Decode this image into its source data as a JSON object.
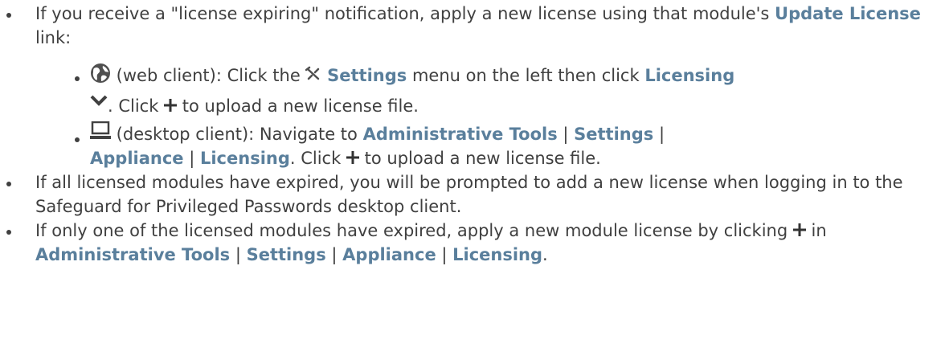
{
  "bullets": [
    {
      "pre": "If you receive a \"license expiring\" notification, apply a new license using that module's ",
      "bold1": "Update License",
      "post": " link:",
      "sub": [
        {
          "icon": "globe-icon",
          "t1": " (web client): Click the ",
          "icon2": "wrench-icon",
          "b1": "Settings",
          "t2": " menu on the left then click ",
          "b2": "Licensing",
          "icon3": "chevron-down-icon",
          "t3": ". Click ",
          "icon4": "plus-icon",
          "t4": " to upload a new license file."
        },
        {
          "icon": "desktop-icon",
          "t1": " (desktop client): Navigate to ",
          "b1": "Administrative Tools",
          "sep1": " | ",
          "b2": "Settings",
          "sep2": " | ",
          "b3": "Appliance",
          "sep3": " | ",
          "b4": "Licensing",
          "t2": ". Click ",
          "icon2": "plus-icon",
          "t3": " to upload a new license file."
        }
      ]
    },
    {
      "text": "If all licensed modules have expired, you will be prompted to add a new license when logging in to the Safeguard for Privileged Passwords desktop client."
    },
    {
      "t1": "If only one of the licensed modules have expired, apply a new module license by clicking ",
      "icon": "plus-icon",
      "t2": " in ",
      "b1": "Administrative Tools",
      "sep1": " | ",
      "b2": "Settings",
      "sep2": " | ",
      "b3": "Appliance",
      "sep3": " | ",
      "b4": "Licensing",
      "t3": "."
    }
  ],
  "colors": {
    "text": "#404040",
    "ui_bold": "#5a7f9c",
    "globe": "#505050"
  }
}
